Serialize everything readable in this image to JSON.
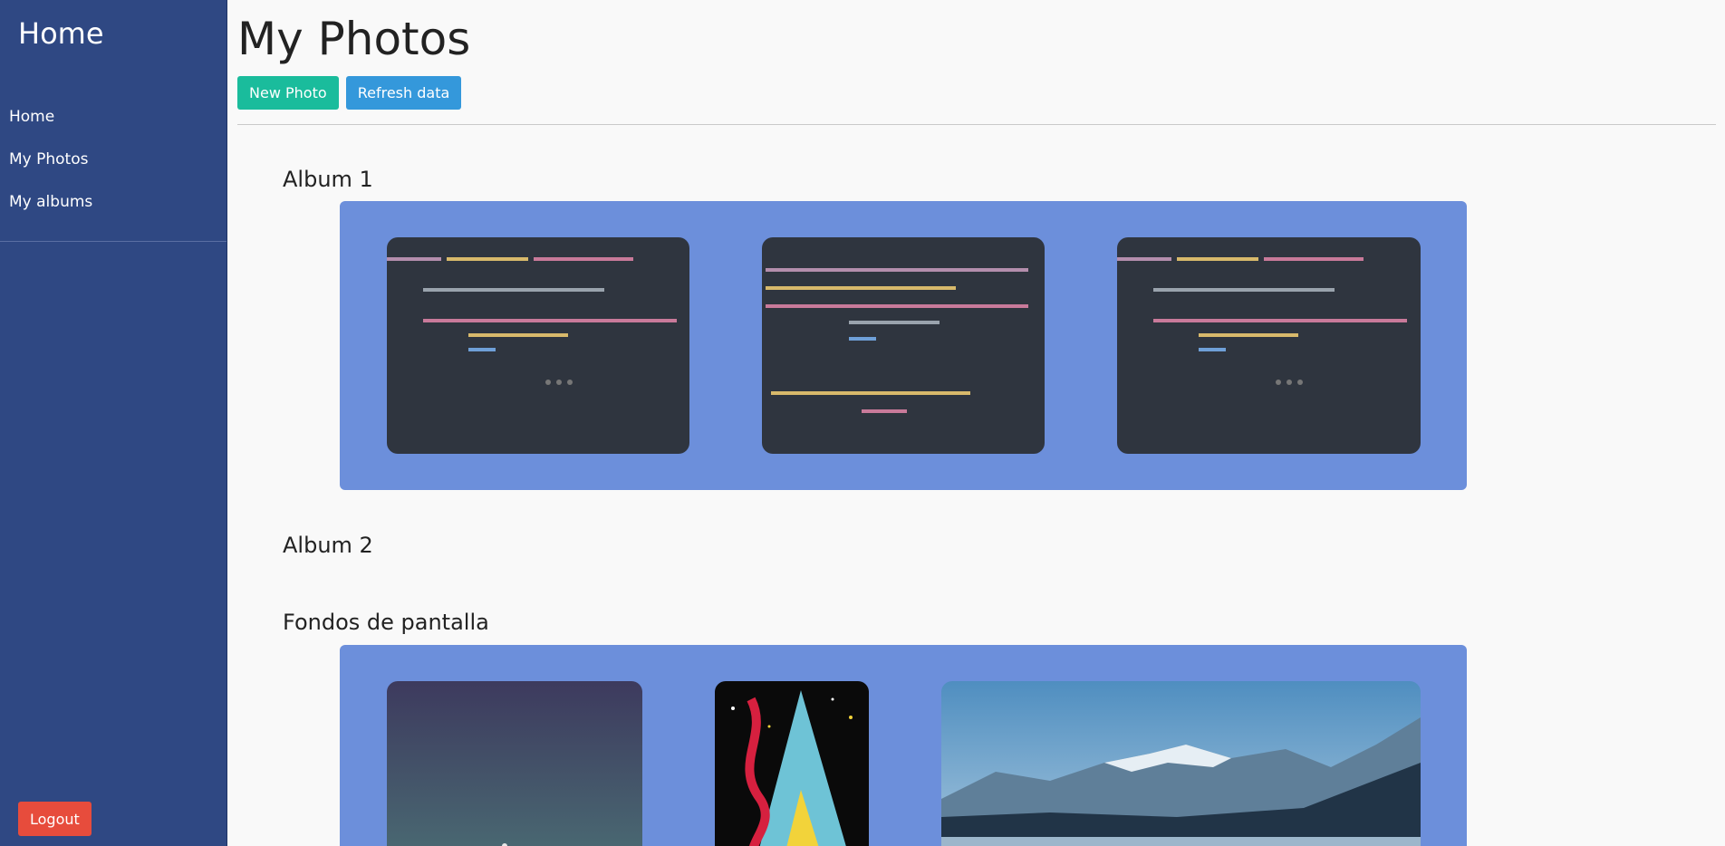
{
  "sidebar": {
    "title": "Home",
    "nav": [
      {
        "label": "Home"
      },
      {
        "label": "My Photos"
      },
      {
        "label": "My albums"
      }
    ],
    "logout_label": "Logout"
  },
  "main": {
    "title": "My Photos",
    "toolbar": {
      "new_photo_label": "New Photo",
      "refresh_label": "Refresh data"
    },
    "albums": [
      {
        "title": "Album 1",
        "photo_count_visible": 3
      },
      {
        "title": "Album 2",
        "photo_count_visible": 0
      },
      {
        "title": "Fondos de pantalla",
        "photo_count_visible": 3
      }
    ]
  },
  "colors": {
    "sidebar_bg": "#2f4883",
    "album_panel_bg": "#6c8fdb",
    "new_photo_btn": "#1abc9c",
    "refresh_btn": "#3498db",
    "logout_btn": "#e74c3c"
  }
}
